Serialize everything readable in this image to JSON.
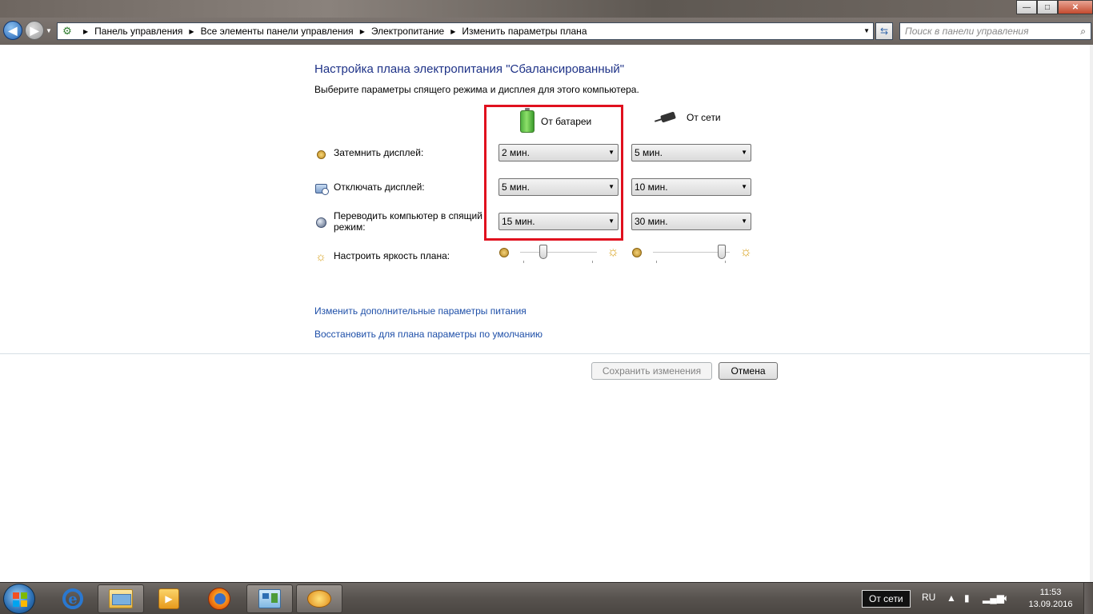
{
  "window": {
    "minimize_glyph": "—",
    "maximize_glyph": "□",
    "close_glyph": "✕"
  },
  "address": {
    "breadcrumbs": [
      "Панель управления",
      "Все элементы панели управления",
      "Электропитание",
      "Изменить параметры плана"
    ],
    "search_placeholder": "Поиск в панели управления"
  },
  "page": {
    "title": "Настройка плана электропитания \"Сбалансированный\"",
    "subtitle": "Выберите параметры спящего режима и дисплея для этого компьютера.",
    "columns": {
      "battery": "От батареи",
      "ac": "От сети"
    },
    "rows": [
      {
        "label": "Затемнить дисплей:",
        "battery": "2 мин.",
        "ac": "5 мин."
      },
      {
        "label": "Отключать дисплей:",
        "battery": "5 мин.",
        "ac": "10 мин."
      },
      {
        "label": "Переводить компьютер в спящий режим:",
        "battery": "15 мин.",
        "ac": "30 мин."
      }
    ],
    "brightness": {
      "label": "Настроить яркость плана:",
      "battery_level": 0.3,
      "ac_level": 0.9
    },
    "links": {
      "advanced": "Изменить дополнительные параметры питания",
      "restore": "Восстановить для плана параметры по умолчанию"
    },
    "buttons": {
      "save": "Сохранить изменения",
      "cancel": "Отмена"
    }
  },
  "taskbar": {
    "tooltip": "От сети",
    "language": "RU",
    "time": "11:53",
    "date": "13.09.2016"
  },
  "icons": {
    "battery": "battery-icon",
    "ac": "power-plug-icon",
    "dim": "sun-dim-icon",
    "display_off": "monitor-clock-icon",
    "sleep": "moon-icon",
    "brightness": "sun-bright-icon"
  },
  "colors": {
    "title": "#1e3287",
    "link": "#1e4fa8",
    "highlight_border": "#e0101e"
  }
}
